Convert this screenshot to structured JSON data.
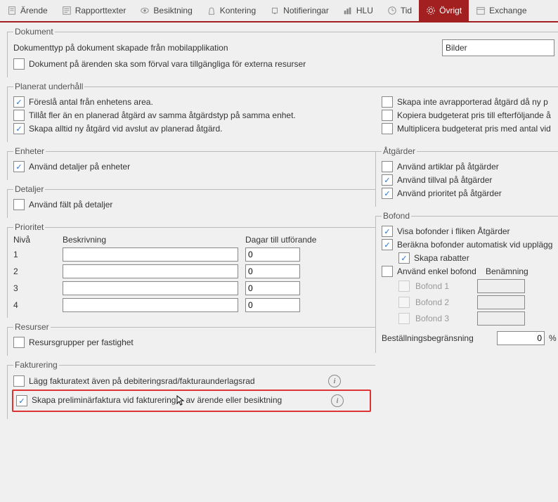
{
  "tabs": {
    "arende": "Ärende",
    "rapporttexter": "Rapporttexter",
    "besiktning": "Besiktning",
    "kontering": "Kontering",
    "notifieringar": "Notifieringar",
    "hlu": "HLU",
    "tid": "Tid",
    "ovrigt": "Övrigt",
    "exchange": "Exchange"
  },
  "dokument": {
    "legend": "Dokument",
    "typ_label": "Dokumenttyp på dokument skapade från mobilapplikation",
    "typ_value": "Bilder",
    "cb1": "Dokument på ärenden ska som förval vara tillgängliga för externa resurser"
  },
  "plan": {
    "legend": "Planerat underhåll",
    "cb1": "Föreslå antal från enhetens area.",
    "cb2": "Tillåt fler än en planerad åtgärd av samma åtgärdstyp på samma enhet.",
    "cb3": "Skapa alltid ny åtgärd vid avslut av planerad åtgärd.",
    "cb4": "Skapa inte avrapporterad åtgärd då ny p",
    "cb5": "Kopiera budgeterat pris till efterföljande å",
    "cb6": "Multiplicera budgeterat pris med antal vid"
  },
  "enheter": {
    "legend": "Enheter",
    "cb1": "Använd detaljer på enheter"
  },
  "atg": {
    "legend": "Åtgärder",
    "cb1": "Använd artiklar på åtgärder",
    "cb2": "Använd tillval på åtgärder",
    "cb3": "Använd prioritet på åtgärder"
  },
  "detaljer": {
    "legend": "Detaljer",
    "cb1": "Använd fält på detaljer"
  },
  "prio": {
    "legend": "Prioritet",
    "h_niv": "Nivå",
    "h_besk": "Beskrivning",
    "h_dagar": "Dagar till utförande",
    "rows": [
      {
        "n": "1",
        "b": "",
        "d": "0"
      },
      {
        "n": "2",
        "b": "",
        "d": "0"
      },
      {
        "n": "3",
        "b": "",
        "d": "0"
      },
      {
        "n": "4",
        "b": "",
        "d": "0"
      }
    ]
  },
  "bofond": {
    "legend": "Bofond",
    "cb1": "Visa bofonder i fliken Åtgärder",
    "cb2": "Beräkna bofonder automatisk vid upplägg",
    "cb3": "Skapa rabatter",
    "cb4": "Använd enkel bofond",
    "benamn": "Benämning",
    "b1": "Bofond 1",
    "b2": "Bofond 2",
    "b3": "Bofond 3",
    "begrans_label": "Beställningsbegränsning",
    "begrans_val": "0",
    "percent": "%"
  },
  "resurser": {
    "legend": "Resurser",
    "cb1": "Resursgrupper per fastighet"
  },
  "fakt": {
    "legend": "Fakturering",
    "cb1": "Lägg fakturatext även på debiteringsrad/fakturaunderlagsrad",
    "cb2_a": "Skapa preliminärfaktura vid fakturering",
    "cb2_b": "av ärende eller besiktning"
  }
}
